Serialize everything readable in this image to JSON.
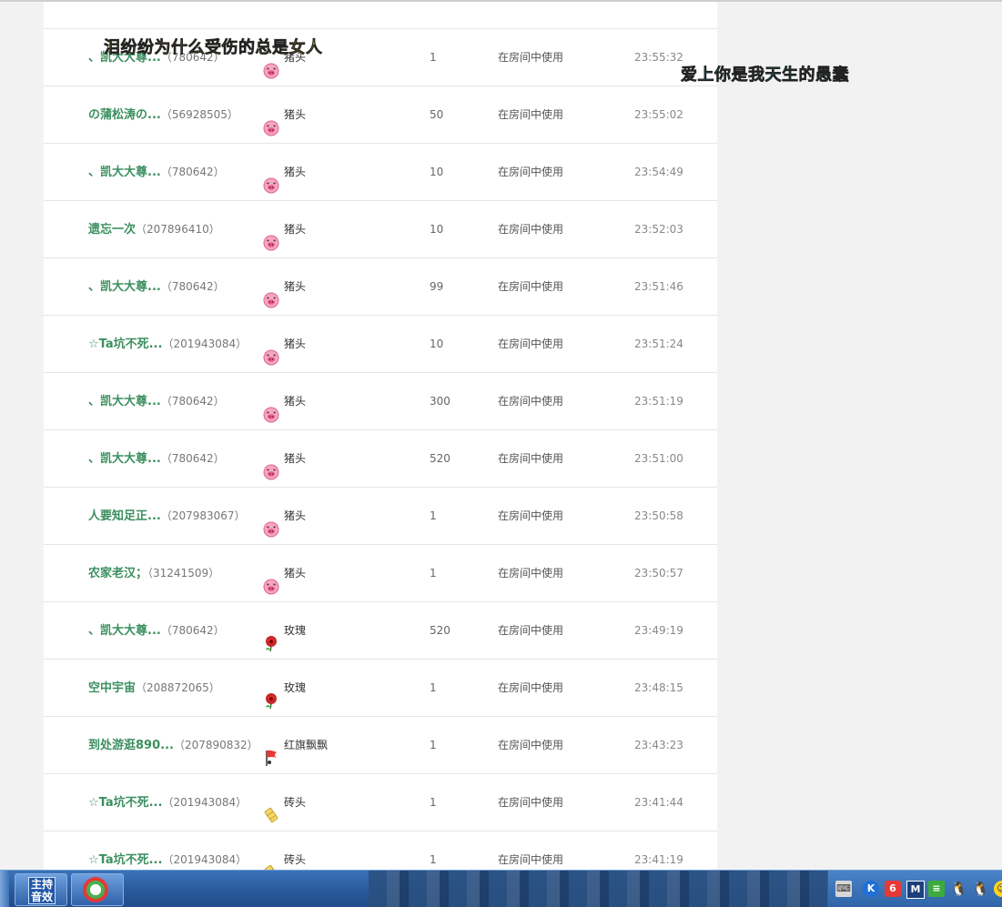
{
  "overlays": {
    "left_text": "泪纷纷为什么受伤的总是女人",
    "right_text": "爱上你是我天生的愚蠢"
  },
  "gift_icons": {
    "pig": "pig-head-icon",
    "rose": "rose-icon",
    "flag": "red-flag-icon",
    "brick": "brick-icon"
  },
  "colors": {
    "sender_name": "#3b8f5f",
    "overlay_left": "#ffd21f",
    "overlay_right": "#29d3e6"
  },
  "records": [
    {
      "name": "、凯大大尊...",
      "uid": "（780642）",
      "icon": "pig",
      "gift": "猪头",
      "qty": "1",
      "use": "在房间中使用",
      "time": "23:55:32"
    },
    {
      "name": "の蒲松涛の...",
      "uid": "（56928505）",
      "icon": "pig",
      "gift": "猪头",
      "qty": "50",
      "use": "在房间中使用",
      "time": "23:55:02"
    },
    {
      "name": "、凯大大尊...",
      "uid": "（780642）",
      "icon": "pig",
      "gift": "猪头",
      "qty": "10",
      "use": "在房间中使用",
      "time": "23:54:49"
    },
    {
      "name": "遗忘一次",
      "uid": "（207896410）",
      "icon": "pig",
      "gift": "猪头",
      "qty": "10",
      "use": "在房间中使用",
      "time": "23:52:03"
    },
    {
      "name": "、凯大大尊...",
      "uid": "（780642）",
      "icon": "pig",
      "gift": "猪头",
      "qty": "99",
      "use": "在房间中使用",
      "time": "23:51:46"
    },
    {
      "name": "☆Ta坑不死...",
      "uid": "（201943084）",
      "icon": "pig",
      "gift": "猪头",
      "qty": "10",
      "use": "在房间中使用",
      "time": "23:51:24"
    },
    {
      "name": "、凯大大尊...",
      "uid": "（780642）",
      "icon": "pig",
      "gift": "猪头",
      "qty": "300",
      "use": "在房间中使用",
      "time": "23:51:19"
    },
    {
      "name": "、凯大大尊...",
      "uid": "（780642）",
      "icon": "pig",
      "gift": "猪头",
      "qty": "520",
      "use": "在房间中使用",
      "time": "23:51:00"
    },
    {
      "name": "人要知足正...",
      "uid": "（207983067）",
      "icon": "pig",
      "gift": "猪头",
      "qty": "1",
      "use": "在房间中使用",
      "time": "23:50:58"
    },
    {
      "name": "农家老汉；",
      "uid": "（31241509）",
      "icon": "pig",
      "gift": "猪头",
      "qty": "1",
      "use": "在房间中使用",
      "time": "23:50:57"
    },
    {
      "name": "、凯大大尊...",
      "uid": "（780642）",
      "icon": "rose",
      "gift": "玫瑰",
      "qty": "520",
      "use": "在房间中使用",
      "time": "23:49:19"
    },
    {
      "name": "空中宇宙",
      "uid": "（208872065）",
      "icon": "rose",
      "gift": "玫瑰",
      "qty": "1",
      "use": "在房间中使用",
      "time": "23:48:15"
    },
    {
      "name": "到处游逛890...",
      "uid": "（207890832）",
      "icon": "flag",
      "gift": "红旗飘飘",
      "qty": "1",
      "use": "在房间中使用",
      "time": "23:43:23"
    },
    {
      "name": "☆Ta坑不死...",
      "uid": "（201943084）",
      "icon": "brick",
      "gift": "砖头",
      "qty": "1",
      "use": "在房间中使用",
      "time": "23:41:44"
    },
    {
      "name": "☆Ta坑不死...",
      "uid": "（201943084）",
      "icon": "brick",
      "gift": "砖头",
      "qty": "1",
      "use": "在房间中使用",
      "time": "23:41:19"
    }
  ],
  "taskbar": {
    "host_button_label": "主持音效",
    "tray": {
      "keyboard": "⌨",
      "k": "K",
      "six": "6",
      "m": "M",
      "g": "≡",
      "q1": "🐧",
      "q2": "🐧",
      "y": "☺"
    }
  }
}
